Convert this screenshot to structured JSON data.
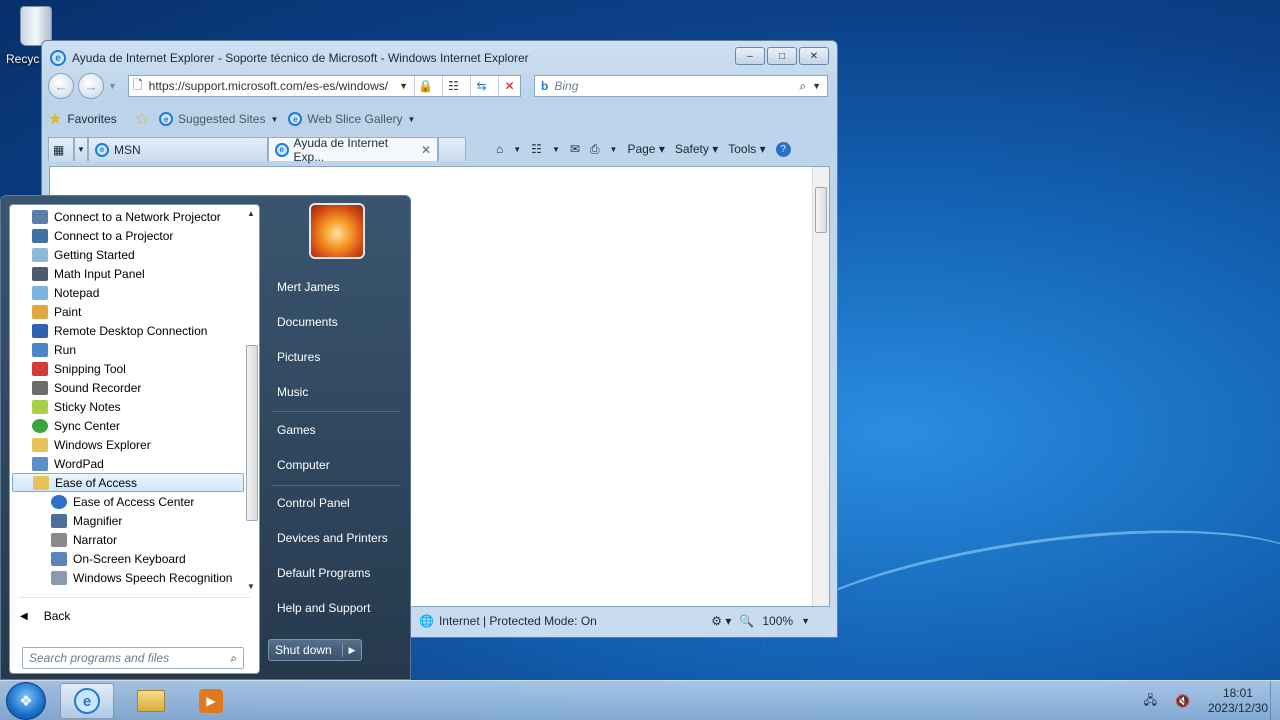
{
  "desktop": {
    "recycle_label": "Recyc"
  },
  "ie": {
    "title": "Ayuda de Internet Explorer - Soporte técnico de Microsoft - Windows Internet Explorer",
    "url": "https://support.microsoft.com/es-es/windows/",
    "search_placeholder": "Bing",
    "favorites_label": "Favorites",
    "suggested_sites": "Suggested Sites",
    "web_slice_gallery": "Web Slice Gallery",
    "tabs": [
      {
        "label": "MSN"
      },
      {
        "label": "Ayuda de Internet Exp..."
      }
    ],
    "tools": {
      "page": "Page",
      "safety": "Safety",
      "tools": "Tools"
    },
    "status_zone": "Internet | Protected Mode: On",
    "zoom": "100%"
  },
  "start_menu": {
    "programs": [
      {
        "label": "Connect to a Network Projector",
        "color": "#5a7fa8"
      },
      {
        "label": "Connect to a Projector",
        "color": "#3d6fa3"
      },
      {
        "label": "Getting Started",
        "color": "#8fb9d8"
      },
      {
        "label": "Math Input Panel",
        "color": "#4d5b6a"
      },
      {
        "label": "Notepad",
        "color": "#7fb3df"
      },
      {
        "label": "Paint",
        "color": "#e0a53c"
      },
      {
        "label": "Remote Desktop Connection",
        "color": "#2d62b0"
      },
      {
        "label": "Run",
        "color": "#4a86c8"
      },
      {
        "label": "Snipping Tool",
        "color": "#d33a3a"
      },
      {
        "label": "Sound Recorder",
        "color": "#6b6b6b"
      },
      {
        "label": "Sticky Notes",
        "color": "#a7cf4a"
      },
      {
        "label": "Sync Center",
        "color": "#3ea53e"
      },
      {
        "label": "Windows Explorer",
        "color": "#e5c45a"
      },
      {
        "label": "WordPad",
        "color": "#5d8fc9"
      }
    ],
    "folder": {
      "label": "Ease of Access",
      "color": "#e8c35c"
    },
    "sub_items": [
      {
        "label": "Ease of Access Center",
        "color": "#2f6fc4"
      },
      {
        "label": "Magnifier",
        "color": "#4b6f9a"
      },
      {
        "label": "Narrator",
        "color": "#8b8b8b"
      },
      {
        "label": "On-Screen Keyboard",
        "color": "#5c86b8"
      },
      {
        "label": "Windows Speech Recognition",
        "color": "#8a9bb0"
      }
    ],
    "back_label": "Back",
    "search_placeholder": "Search programs and files",
    "right_items": [
      "Mert James",
      "Documents",
      "Pictures",
      "Music",
      "Games",
      "Computer",
      "Control Panel",
      "Devices and Printers",
      "Default Programs",
      "Help and Support"
    ],
    "shutdown_label": "Shut down"
  },
  "taskbar": {
    "time": "18:01",
    "date": "2023/12/30"
  }
}
